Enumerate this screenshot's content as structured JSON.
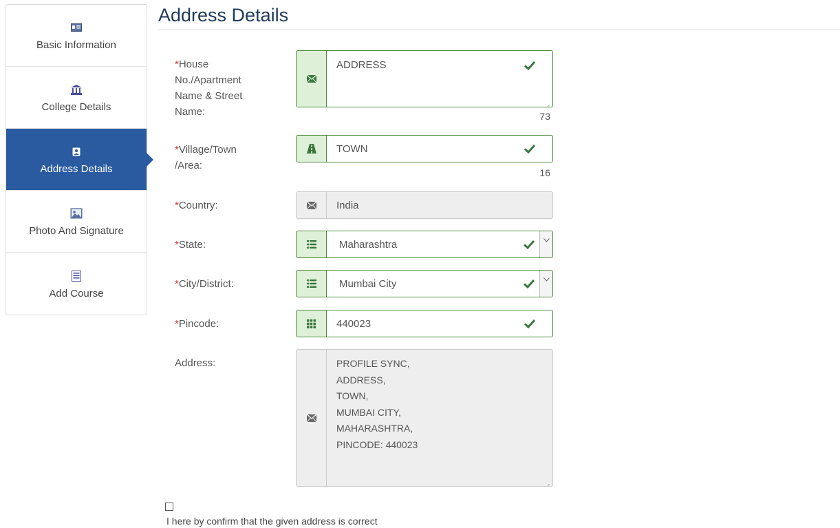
{
  "sidebar": {
    "items": [
      {
        "label": "Basic Information",
        "icon": "id-card-icon",
        "active": false
      },
      {
        "label": "College Details",
        "icon": "institution-icon",
        "active": false
      },
      {
        "label": "Address Details",
        "icon": "contact-card-icon",
        "active": true
      },
      {
        "label": "Photo And Signature",
        "icon": "picture-icon",
        "active": false
      },
      {
        "label": "Add Course",
        "icon": "list-icon",
        "active": false
      }
    ]
  },
  "page": {
    "title": "Address Details"
  },
  "form": {
    "house": {
      "label_req": "*",
      "label": "House No./Apartment Name & Street Name:",
      "value": "ADDRESS",
      "counter": "73",
      "icon": "envelope-icon"
    },
    "village": {
      "label_req": "*",
      "label": "Village/Town /Area:",
      "value": "TOWN",
      "counter": "16",
      "icon": "road-icon"
    },
    "country": {
      "label_req": "*",
      "label": "Country:",
      "value": "India",
      "icon": "envelope-icon"
    },
    "state": {
      "label_req": "*",
      "label": "State:",
      "value": "Maharashtra",
      "icon": "list-icon"
    },
    "city": {
      "label_req": "*",
      "label": "City/District:",
      "value": "Mumbai City",
      "icon": "list-icon"
    },
    "pincode": {
      "label_req": "*",
      "label": "Pincode:",
      "value": "440023",
      "icon": "grid-icon"
    },
    "address": {
      "label": "Address:",
      "lines": [
        "PROFILE SYNC,",
        "ADDRESS,",
        "TOWN,",
        "MUMBAI CITY,",
        "MAHARASHTRA,",
        "PINCODE: 440023"
      ],
      "icon": "envelope-icon"
    }
  },
  "confirm": {
    "label": "I here by confirm that the given address is correct",
    "checked": false
  },
  "colors": {
    "accent": "#2a5aa0",
    "success": "#3c763d",
    "success_bg": "#dff0d8",
    "required": "#c0392b",
    "title": "#1e3a5c"
  }
}
